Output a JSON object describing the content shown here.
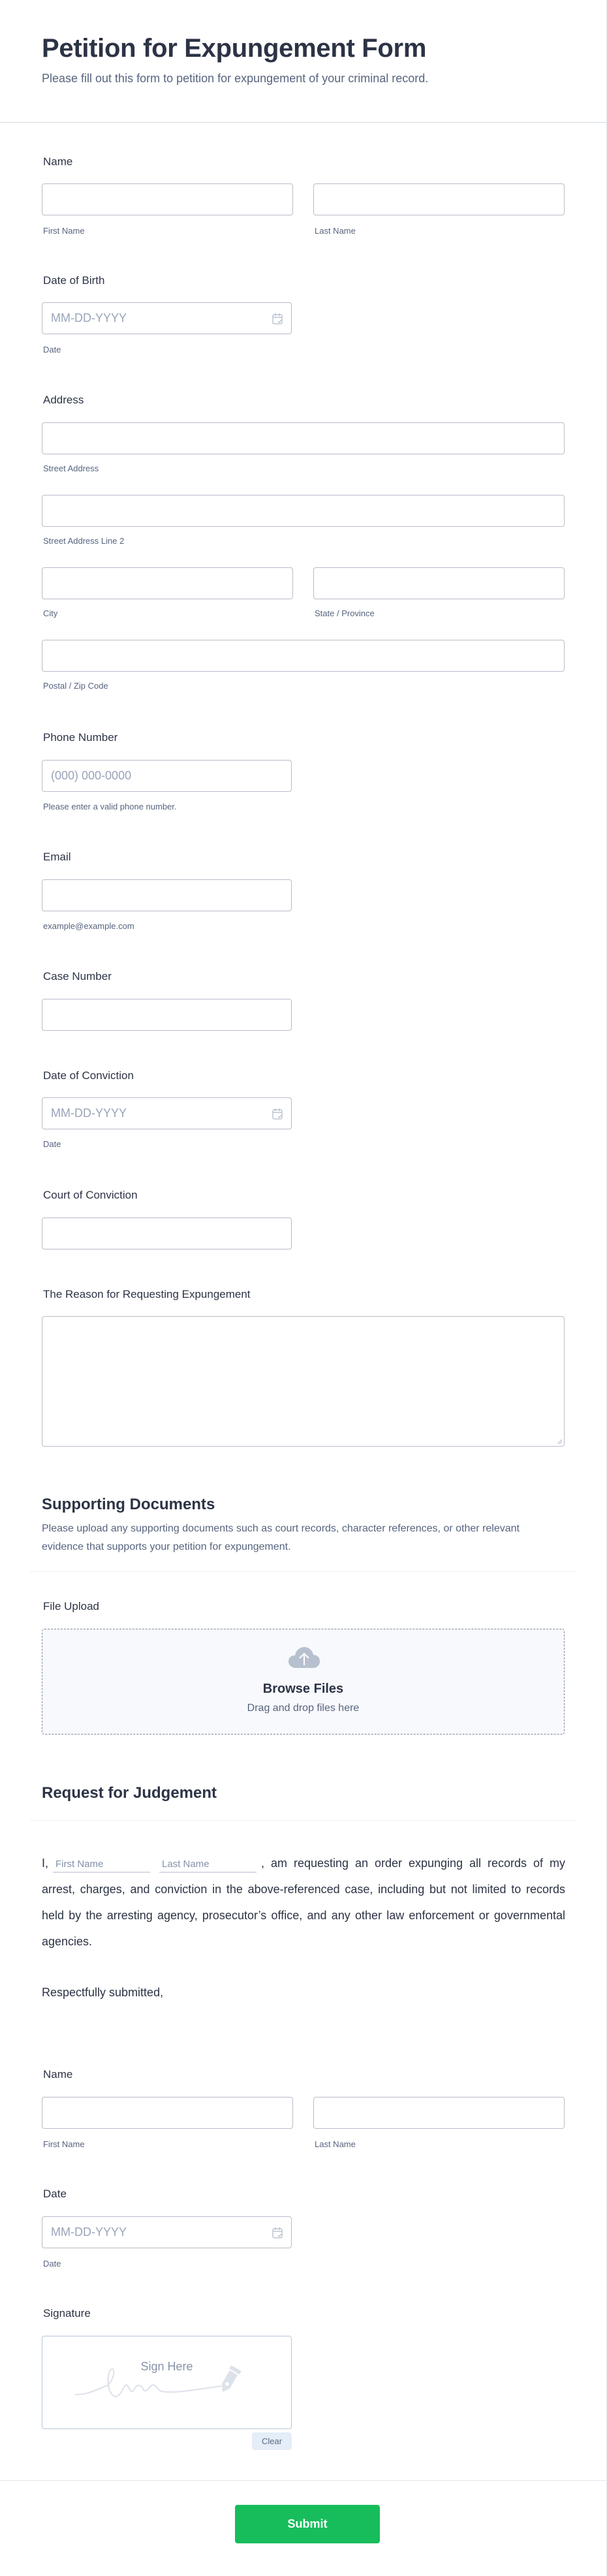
{
  "header": {
    "title": "Petition for Expungement Form",
    "subtitle": "Please fill out this form to petition for expungement of your criminal record."
  },
  "fields": {
    "name": {
      "label": "Name",
      "first_sublabel": "First Name",
      "last_sublabel": "Last Name",
      "first_value": "",
      "last_value": ""
    },
    "dob": {
      "label": "Date of Birth",
      "placeholder": "MM-DD-YYYY",
      "sublabel": "Date",
      "icon": "calendar-icon"
    },
    "address": {
      "label": "Address",
      "street_sublabel": "Street Address",
      "street2_sublabel": "Street Address Line 2",
      "city_sublabel": "City",
      "state_sublabel": "State / Province",
      "zip_sublabel": "Postal / Zip Code"
    },
    "phone": {
      "label": "Phone Number",
      "placeholder": "(000) 000-0000",
      "sublabel": "Please enter a valid phone number."
    },
    "email": {
      "label": "Email",
      "sublabel": "example@example.com"
    },
    "case_number": {
      "label": "Case Number"
    },
    "conviction_date": {
      "label": "Date of Conviction",
      "placeholder": "MM-DD-YYYY",
      "sublabel": "Date",
      "icon": "calendar-icon"
    },
    "court": {
      "label": "Court of Conviction"
    },
    "reason": {
      "label": "The Reason for Requesting Expungement"
    }
  },
  "supporting": {
    "title": "Supporting Documents",
    "description": "Please upload any supporting documents such as court records, character references, or other relevant evidence that supports your petition for expungement.",
    "upload_label": "File Upload",
    "browse": "Browse Files",
    "drag": "Drag and drop files here",
    "icon": "cloud-upload-icon"
  },
  "judgement": {
    "title": "Request for Judgement",
    "prefix": "I,",
    "first_placeholder": "First Name",
    "last_placeholder": "Last Name",
    "body": ", am requesting an order expunging all records of my arrest, charges, and conviction in the above-referenced case, including but not limited to records held by the arresting agency, prosecutor’s office, and any other law enforcement or governmental agencies.",
    "closing": "Respectfully submitted,"
  },
  "signoff": {
    "name": {
      "label": "Name",
      "first_sublabel": "First Name",
      "last_sublabel": "Last Name"
    },
    "date": {
      "label": "Date",
      "placeholder": "MM-DD-YYYY",
      "sublabel": "Date"
    },
    "signature": {
      "label": "Signature",
      "hint": "Sign Here",
      "clear": "Clear"
    }
  },
  "submit": {
    "label": "Submit",
    "color": "#18bd5b"
  }
}
